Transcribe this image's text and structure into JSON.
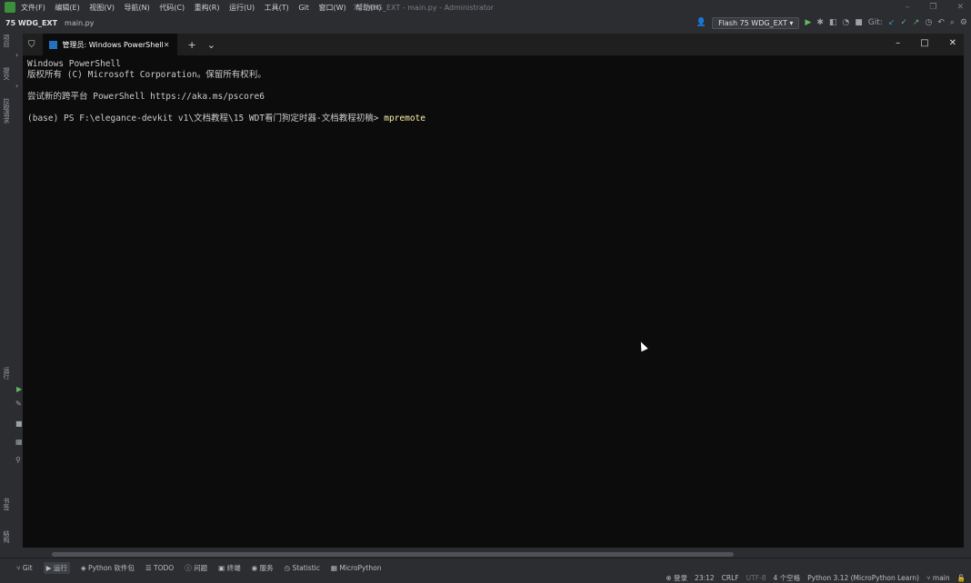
{
  "titlebar": {
    "menu": [
      "文件(F)",
      "编辑(E)",
      "视图(V)",
      "导航(N)",
      "代码(C)",
      "重构(R)",
      "运行(U)",
      "工具(T)",
      "Git",
      "窗口(W)",
      "帮助(H)"
    ],
    "window_title": "75 WDG_EXT - main.py - Administrator"
  },
  "navbar": {
    "project": "75 WDG_EXT",
    "file": "main.py",
    "run_config": "Flash 75 WDG_EXT",
    "git_label": "Git:"
  },
  "leftstrip": {
    "label1": "项目",
    "label2": "提交",
    "label3": "拉取请求",
    "label4": "运行",
    "label5": "书签",
    "label6": "结构"
  },
  "terminal": {
    "tab_title": "管理员: Windows PowerShell",
    "lines": [
      "Windows PowerShell",
      "版权所有 (C) Microsoft Corporation。保留所有权利。",
      "",
      "尝试新的跨平台 PowerShell https://aka.ms/pscore6",
      ""
    ],
    "prompt": "(base) PS F:\\elegance-devkit v1\\文档教程\\15 WDT看门狗定时器-文档教程初稿> ",
    "command": "mpremote"
  },
  "statusbar": {
    "tools": [
      "Git",
      "运行",
      "Python 软件包",
      "TODO",
      "问题",
      "终端",
      "服务",
      "Statistic",
      "MicroPython"
    ],
    "login": "登录",
    "position": "23:12",
    "line_sep": "CRLF",
    "encoding": "UTF-8",
    "indent": "4 个空格",
    "interpreter": "Python 3.12 (MicroPython Learn)",
    "branch": "main"
  }
}
